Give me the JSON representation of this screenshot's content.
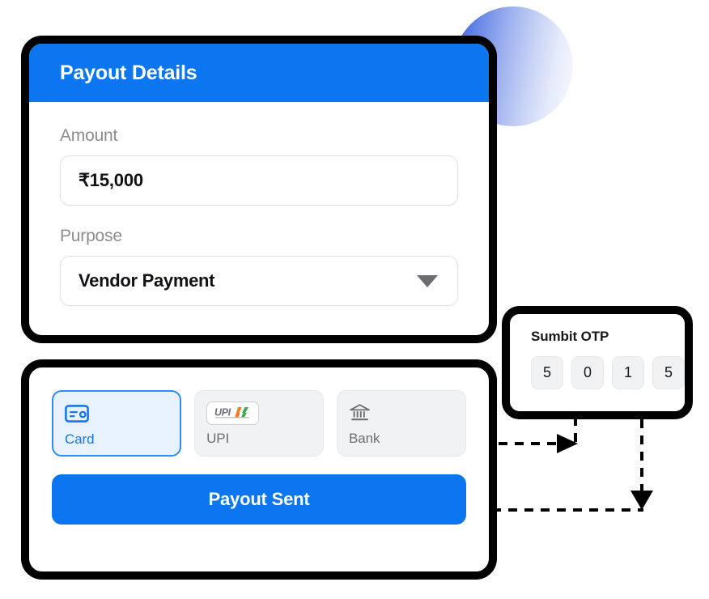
{
  "payout_details": {
    "header_title": "Payout Details",
    "amount": {
      "label": "Amount",
      "value": "₹15,000"
    },
    "purpose": {
      "label": "Purpose",
      "value": "Vendor Payment",
      "caret_icon": "chevron-down-icon"
    }
  },
  "payment_methods": {
    "tiles": [
      {
        "label": "Card",
        "icon": "credit-card-icon",
        "selected": true
      },
      {
        "label": "UPI",
        "icon": "upi-logo-icon",
        "logo_text": "UPI",
        "selected": false
      },
      {
        "label": "Bank",
        "icon": "bank-building-icon",
        "selected": false
      }
    ],
    "primary_button": "Payout Sent"
  },
  "otp": {
    "title": "Sumbit OTP",
    "digits": [
      "5",
      "0",
      "1",
      "5"
    ]
  },
  "colors": {
    "brand_blue": "#0b76ef",
    "accent_blue": "#2f8bf5",
    "tile_grey": "#f1f2f3",
    "outline_black": "#000000",
    "label_grey": "#8c8c8c"
  },
  "decor": {
    "circle": "gradient-circle-decoration"
  },
  "connectors": [
    {
      "name": "tabs-to-otp-arrow",
      "direction": "right-then-up"
    },
    {
      "name": "payout-sent-to-otp-arrow",
      "direction": "right-and-down"
    }
  ]
}
